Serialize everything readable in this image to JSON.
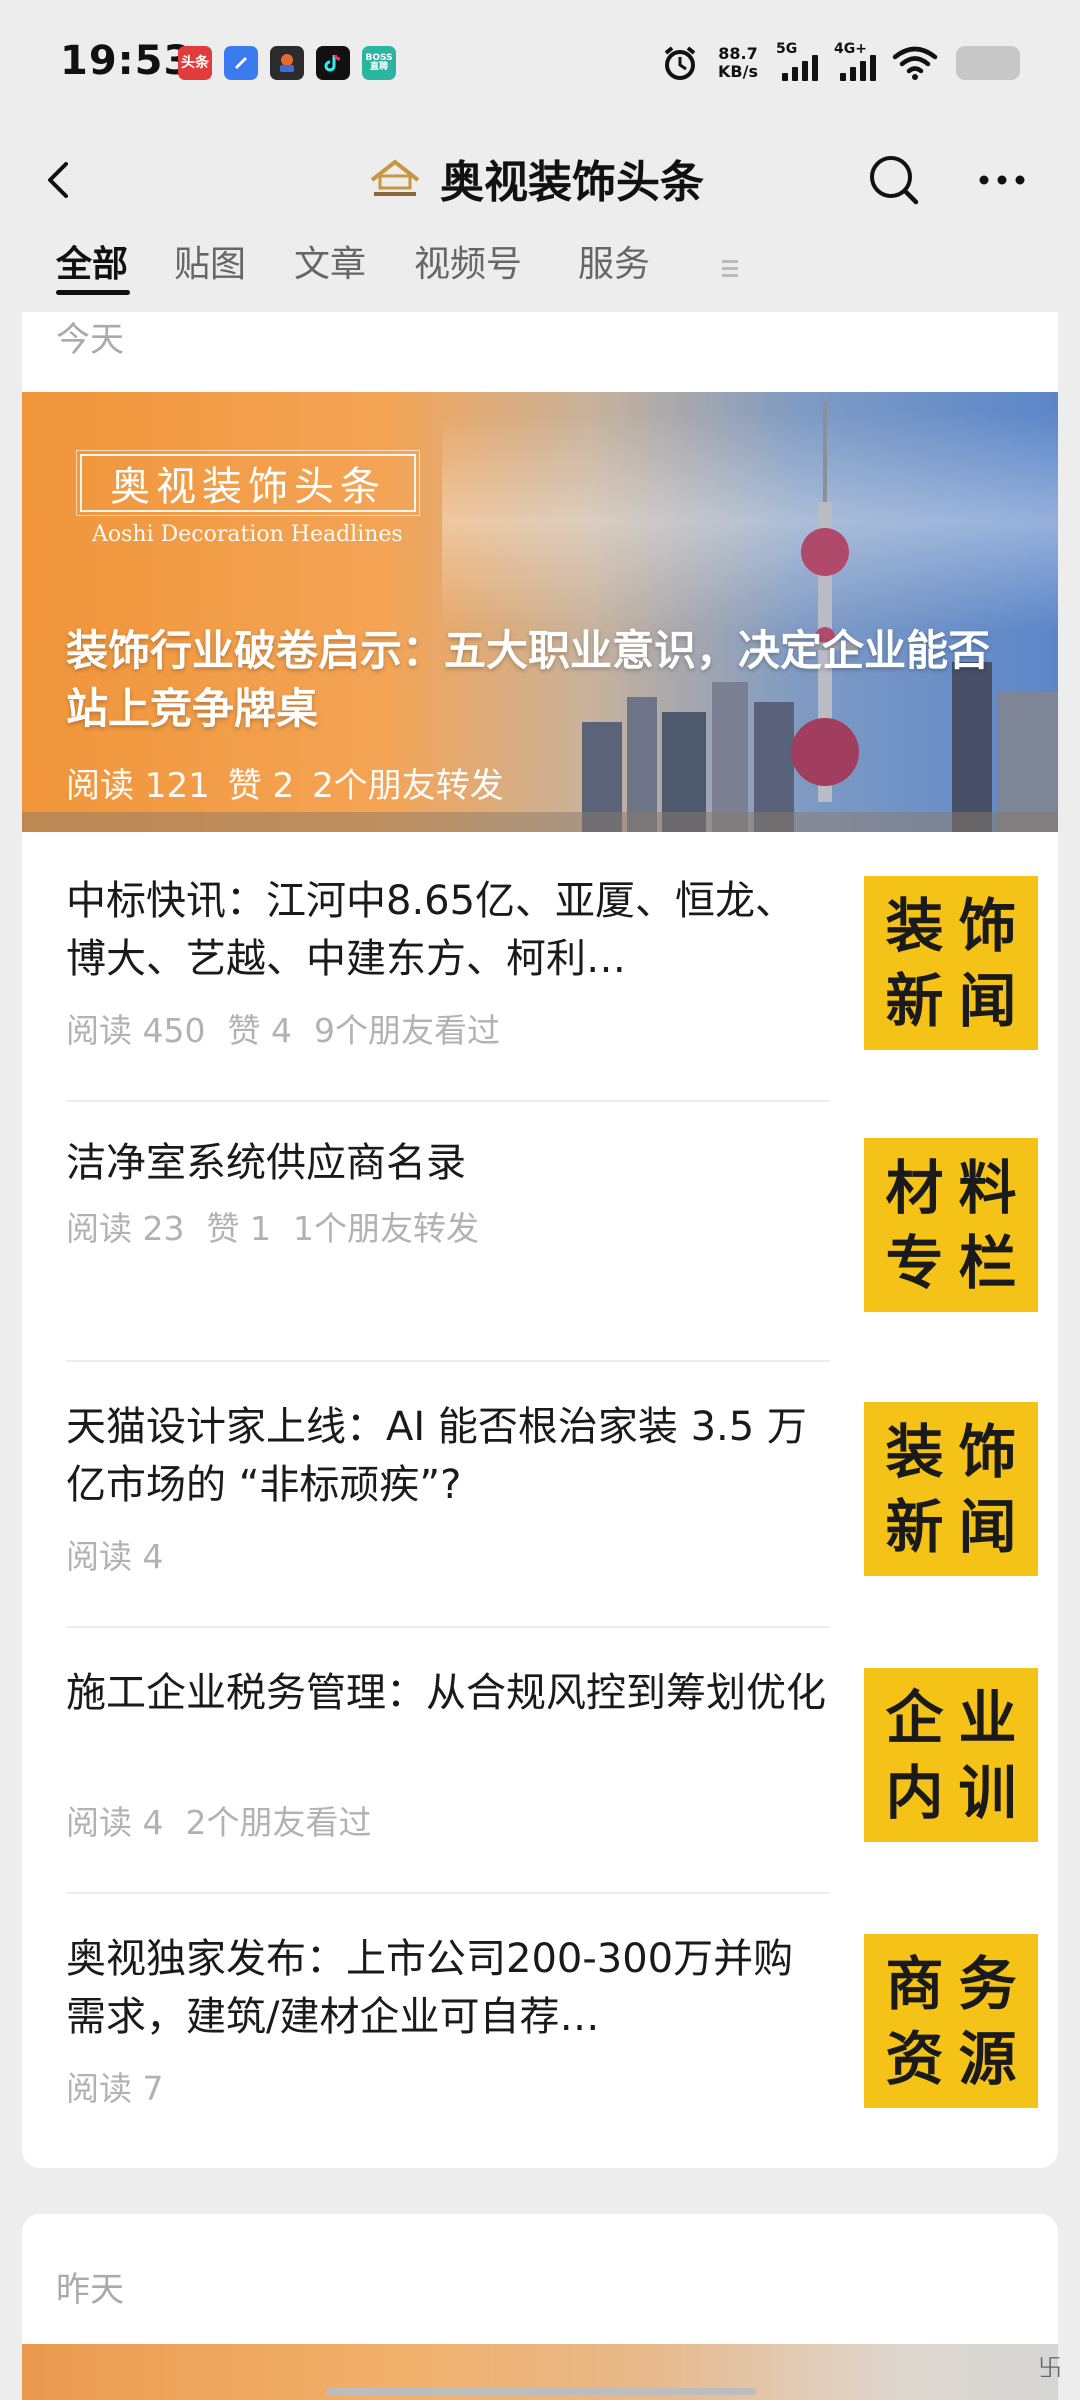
{
  "status_bar": {
    "time": "19:53",
    "net_speed_value": "88.7",
    "net_speed_unit": "KB/s",
    "sim1_label": "5G",
    "sim2_label": "4G+",
    "notifications": [
      {
        "label": "头条",
        "color": "#e23b3b",
        "icon": "toutiao-icon"
      },
      {
        "label": "",
        "color": "#3a7bf0",
        "icon": "app-blue-icon"
      },
      {
        "label": "",
        "color": "#2b2b2b",
        "icon": "game-icon"
      },
      {
        "label": "",
        "color": "#111111",
        "icon": "tiktok-icon"
      },
      {
        "label": "BOSS\n直聘",
        "color": "#2bb5a0",
        "icon": "boss-icon"
      }
    ]
  },
  "header": {
    "title": "奥视装饰头条"
  },
  "tabs": [
    {
      "label": "全部",
      "active": true
    },
    {
      "label": "贴图",
      "active": false
    },
    {
      "label": "文章",
      "active": false
    },
    {
      "label": "视频号",
      "active": false
    },
    {
      "label": "服务",
      "active": false
    }
  ],
  "sections": [
    {
      "date": "今天"
    },
    {
      "date": "昨天"
    }
  ],
  "featured": {
    "brand_cn": "奥视装饰头条",
    "brand_en": "Aoshi Decoration Headlines",
    "title": "装饰行业破卷启示：五大职业意识，决定企业能否站上竞争牌桌",
    "meta": [
      "阅读 121",
      "赞 2",
      "2个朋友转发"
    ]
  },
  "articles": [
    {
      "title": "中标快讯：江河中8.65亿、亚厦、恒龙、博大、艺越、中建东方、柯利…",
      "meta": [
        "阅读 450",
        "赞 4",
        "9个朋友看过"
      ],
      "thumb": [
        "装",
        "饰",
        "新",
        "闻"
      ]
    },
    {
      "title": "洁净室系统供应商名录",
      "meta": [
        "阅读 23",
        "赞 1",
        "1个朋友转发"
      ],
      "thumb": [
        "材",
        "料",
        "专",
        "栏"
      ]
    },
    {
      "title": "天猫设计家上线：AI 能否根治家装 3.5 万亿市场的 “非标顽疾”?",
      "meta": [
        "阅读 4"
      ],
      "thumb": [
        "装",
        "饰",
        "新",
        "闻"
      ]
    },
    {
      "title": "施工企业税务管理：从合规风控到筹划优化",
      "meta": [
        "阅读 4",
        "2个朋友看过"
      ],
      "thumb": [
        "企",
        "业",
        "内",
        "训"
      ]
    },
    {
      "title": "奥视独家发布：上市公司200-300万并购需求，建筑/建材企业可自荐…",
      "meta": [
        "阅读 7"
      ],
      "thumb": [
        "商",
        "务",
        "资",
        "源"
      ]
    }
  ],
  "colors": {
    "thumb_bg": "#f5c218",
    "page_bg": "#ededed"
  }
}
